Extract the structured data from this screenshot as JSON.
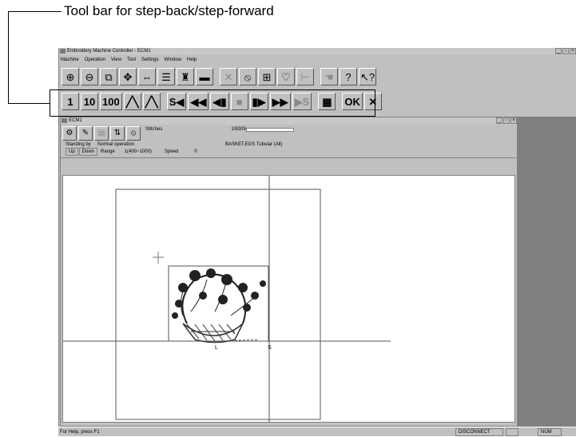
{
  "callout": {
    "text": "Tool bar for step-back/step-forward"
  },
  "window": {
    "title": "Embroidery Machine Controller - ECM1",
    "controls": [
      "_",
      "▫",
      "×"
    ]
  },
  "menu": [
    "Machine",
    "Operation",
    "View",
    "Tool",
    "Settings",
    "Window",
    "Help"
  ],
  "toolbar1": [
    {
      "name": "zoom-in-icon",
      "glyph": "⊕"
    },
    {
      "name": "zoom-out-icon",
      "glyph": "⊖"
    },
    {
      "name": "zoom-window-icon",
      "glyph": "⧉"
    },
    {
      "name": "fit-icon",
      "glyph": "✥"
    },
    {
      "name": "center-icon",
      "glyph": "⇔"
    },
    {
      "name": "lines-icon",
      "glyph": "☰"
    },
    {
      "name": "bobbin-icon",
      "glyph": "♜"
    },
    {
      "name": "frame-icon",
      "glyph": "▬"
    },
    {
      "name": "cancel-icon",
      "glyph": "✕",
      "dim": true
    },
    {
      "name": "stop-icon",
      "glyph": "⦸"
    },
    {
      "name": "grid-icon",
      "glyph": "⊞"
    },
    {
      "name": "design-icon",
      "glyph": "♡"
    },
    {
      "name": "tree-icon",
      "glyph": "⊢",
      "dim": true
    },
    {
      "name": "pointer-icon",
      "glyph": "☚",
      "dim": true
    },
    {
      "name": "help-icon",
      "glyph": "?"
    },
    {
      "name": "context-help-icon",
      "glyph": "↖?"
    }
  ],
  "toolbar2": [
    {
      "name": "step-1-button",
      "label": "1"
    },
    {
      "name": "step-10-button",
      "label": "10"
    },
    {
      "name": "step-100-button",
      "label": "100"
    },
    {
      "name": "up-shape-icon",
      "label": "╱╲"
    },
    {
      "name": "dotted-up-icon",
      "label": "╱╲"
    },
    {
      "name": "go-start-button",
      "label": "S◀"
    },
    {
      "name": "fast-back-button",
      "label": "◀◀"
    },
    {
      "name": "step-back-button",
      "label": "◀▮"
    },
    {
      "name": "stop-button",
      "label": "■",
      "dim": true
    },
    {
      "name": "step-forward-button",
      "label": "▮▶"
    },
    {
      "name": "fast-forward-button",
      "label": "▶▶"
    },
    {
      "name": "go-end-button",
      "label": "▶S",
      "dim": true
    },
    {
      "name": "grid-select-button",
      "label": "▦"
    },
    {
      "name": "ok-button",
      "label": "OK"
    },
    {
      "name": "close-button",
      "label": "✕"
    }
  ],
  "child": {
    "title": "ECM1",
    "stitches_label": "Stitches",
    "stitches_value": "1/8309",
    "status": "Standing by",
    "mode": "Normal operation",
    "file": "BASKET.EGS Tubular (All)",
    "up": "Up",
    "down": "Down",
    "range_label": "Range",
    "range_value": "1(400~1000)",
    "speed_label": "Speed",
    "speed_value": "0"
  },
  "canvas": {
    "label_l": "L",
    "label_s": "S"
  },
  "status": {
    "help": "For Help, press F1",
    "connection": "DISCONNECT",
    "num": "NUM"
  }
}
